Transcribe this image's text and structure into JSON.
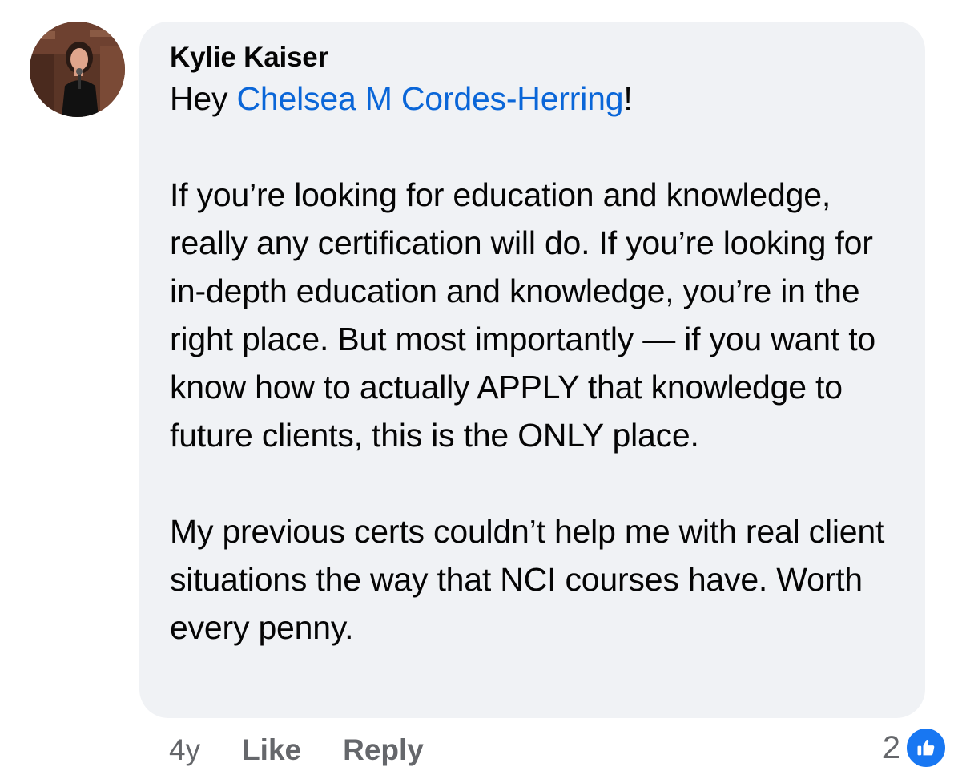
{
  "comment": {
    "author": "Kylie Kaiser",
    "greeting_prefix": "Hey ",
    "mention": "Chelsea M Cordes-Herring",
    "greeting_suffix": "!",
    "paragraph_1": "If you’re looking for education and knowledge, really any certification will do. If you’re looking for in-depth education and knowledge, you’re in the right place. But most importantly — if you want to know how to actually APPLY that knowledge to future clients, this is the ONLY place.",
    "paragraph_2": "My previous certs couldn’t help me with real client situations the way that NCI courses have. Worth every penny."
  },
  "actions": {
    "time": "4y",
    "like": "Like",
    "reply": "Reply"
  },
  "reactions": {
    "count": "2",
    "icon": "thumbs-up-icon",
    "color": "#1877f2"
  },
  "colors": {
    "bubble": "#f0f2f5",
    "mention": "#0a66d8",
    "meta": "#65676b"
  }
}
